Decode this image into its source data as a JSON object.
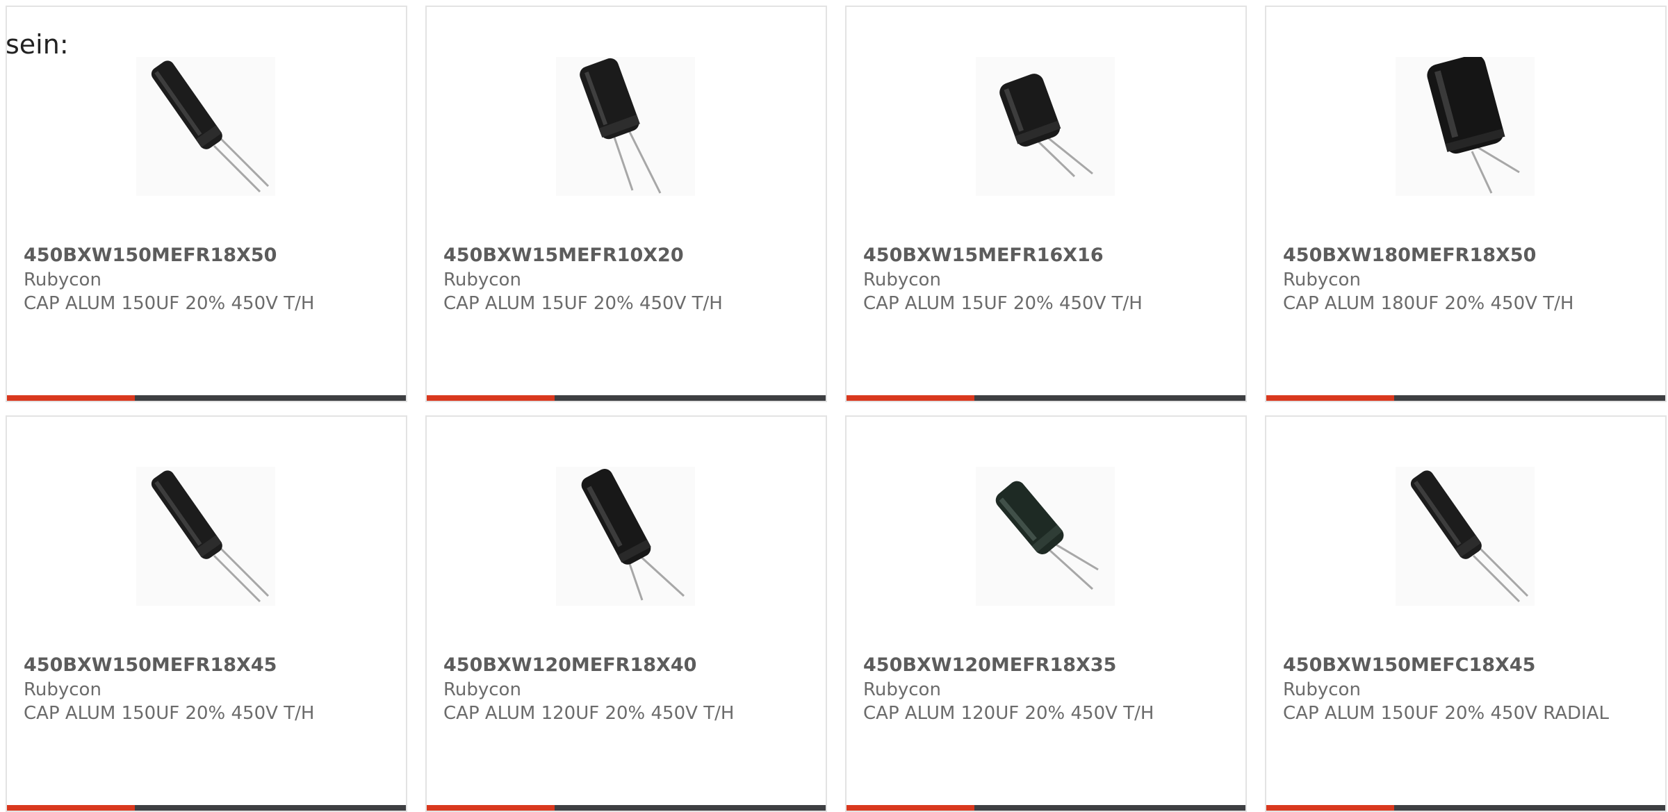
{
  "page": {
    "intro_text": "sein:"
  },
  "colors": {
    "accent": "#d9381e",
    "bar": "#3e3f42",
    "card_border": "#e3e3e3",
    "text": "#6b6b6b"
  },
  "products": [
    {
      "part_number": "450BXW150MEFR18X50",
      "manufacturer": "Rubycon",
      "description": "CAP ALUM 150UF 20% 450V T/H",
      "image_icon": "capacitor-slim-tilted"
    },
    {
      "part_number": "450BXW15MEFR10X20",
      "manufacturer": "Rubycon",
      "description": "CAP ALUM 15UF 20% 450V T/H",
      "image_icon": "capacitor-medium"
    },
    {
      "part_number": "450BXW15MEFR16X16",
      "manufacturer": "Rubycon",
      "description": "CAP ALUM 15UF 20% 450V T/H",
      "image_icon": "capacitor-short"
    },
    {
      "part_number": "450BXW180MEFR18X50",
      "manufacturer": "Rubycon",
      "description": "CAP ALUM 180UF 20% 450V T/H",
      "image_icon": "capacitor-wide"
    },
    {
      "part_number": "450BXW150MEFR18X45",
      "manufacturer": "Rubycon",
      "description": "CAP ALUM 150UF 20% 450V T/H",
      "image_icon": "capacitor-slim-tilted"
    },
    {
      "part_number": "450BXW120MEFR18X40",
      "manufacturer": "Rubycon",
      "description": "CAP ALUM 120UF 20% 450V T/H",
      "image_icon": "capacitor-medium"
    },
    {
      "part_number": "450BXW120MEFR18X35",
      "manufacturer": "Rubycon",
      "description": "CAP ALUM 120UF 20% 450V T/H",
      "image_icon": "capacitor-green"
    },
    {
      "part_number": "450BXW150MEFC18X45",
      "manufacturer": "Rubycon",
      "description": "CAP ALUM 150UF 20% 450V RADIAL",
      "image_icon": "capacitor-slim-tilted"
    }
  ]
}
